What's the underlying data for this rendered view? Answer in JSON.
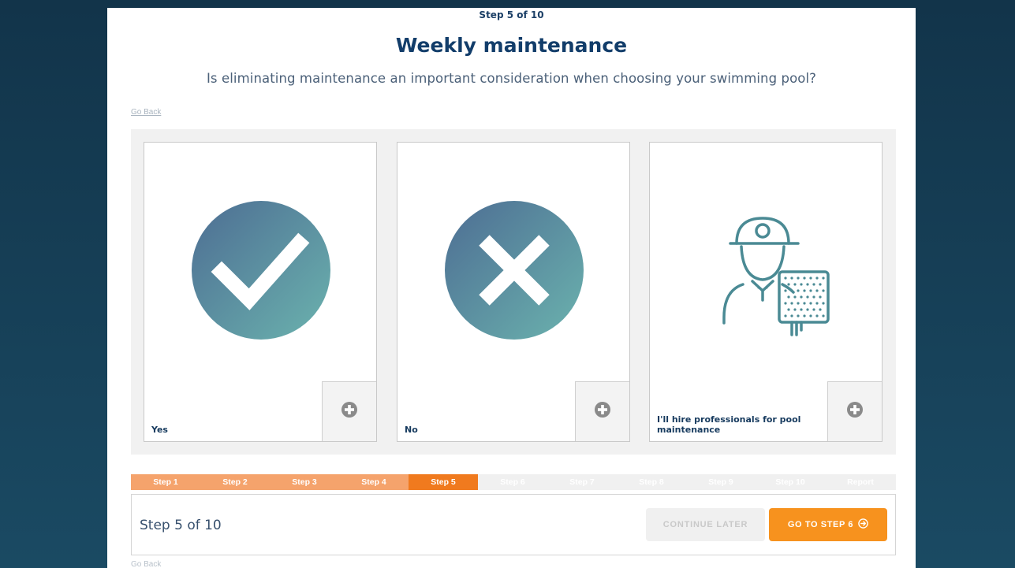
{
  "header": {
    "step_indicator": "Step 5 of 10",
    "title": "Weekly maintenance",
    "subtitle": "Is eliminating maintenance an important consideration when choosing your swimming pool?",
    "go_back": "Go Back"
  },
  "options": [
    {
      "label": "Yes",
      "icon": "checkmark-circle-icon"
    },
    {
      "label": "No",
      "icon": "x-circle-icon"
    },
    {
      "label": "I'll hire professionals for pool maintenance",
      "icon": "pool-technician-icon"
    }
  ],
  "progress": {
    "steps": [
      "Step 1",
      "Step 2",
      "Step 3",
      "Step 4",
      "Step 5",
      "Step 6",
      "Step 7",
      "Step 8",
      "Step 9",
      "Step 10",
      "Report"
    ],
    "current_index": 4
  },
  "footer": {
    "step_text": "Step 5 of 10",
    "continue_later": "CONTINUE LATER",
    "next_button": "GO TO STEP 6",
    "go_back": "Go Back"
  },
  "colors": {
    "background": "#12344a",
    "heading": "#123d6a",
    "progress_done": "#f5a36c",
    "progress_current": "#f07a1e",
    "primary_button": "#f7921e",
    "icon_teal": "#4a8a94"
  }
}
